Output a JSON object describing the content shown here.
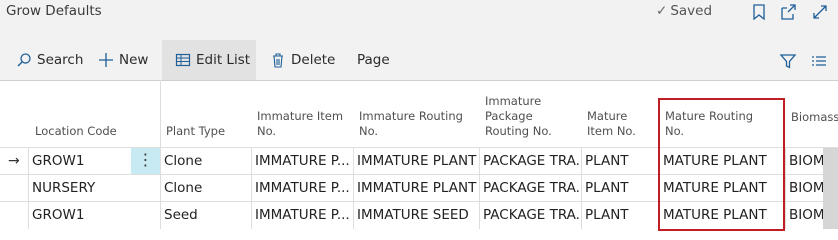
{
  "page": {
    "title": "Grow Defaults",
    "status": "Saved"
  },
  "toolbar": {
    "search": "Search",
    "new": "New",
    "edit_list": "Edit List",
    "delete": "Delete",
    "page": "Page"
  },
  "columns": {
    "location_code": "Location Code",
    "plant_type": "Plant Type",
    "immature_item_no_1": "Immature Item",
    "immature_item_no_2": "No.",
    "immature_routing_no_1": "Immature Routing",
    "immature_routing_no_2": "No.",
    "immature_pkg_1": "Immature",
    "immature_pkg_2": "Package",
    "immature_pkg_3": "Routing No.",
    "mature_item_1": "Mature",
    "mature_item_2": "Item No.",
    "mature_routing_1": "Mature Routing",
    "mature_routing_2": "No.",
    "biomass": "Biomass"
  },
  "rows": [
    {
      "location": "GROW1",
      "plant_type": "Clone",
      "imm_item": "IMMATURE P...",
      "imm_routing": "IMMATURE PLANT",
      "imm_pkg": "PACKAGE TRA...",
      "mat_item": "PLANT",
      "mat_routing": "MATURE PLANT",
      "biomass": "BIOM"
    },
    {
      "location": "NURSERY",
      "plant_type": "Clone",
      "imm_item": "IMMATURE P...",
      "imm_routing": "IMMATURE PLANT",
      "imm_pkg": "PACKAGE TRA...",
      "mat_item": "PLANT",
      "mat_routing": "MATURE PLANT",
      "biomass": "BIOM"
    },
    {
      "location": "GROW1",
      "plant_type": "Seed",
      "imm_item": "IMMATURE P...",
      "imm_routing": "IMMATURE SEED",
      "imm_pkg": "PACKAGE TRA...",
      "mat_item": "PLANT",
      "mat_routing": "MATURE PLANT",
      "biomass": "BIOM"
    }
  ],
  "row_menu_glyph": "⋮",
  "row_arrow_glyph": "→",
  "colors": {
    "highlight_border": "#c01d24",
    "selected_cell": "#c8eaf3",
    "accent": "#0b6aa2"
  }
}
